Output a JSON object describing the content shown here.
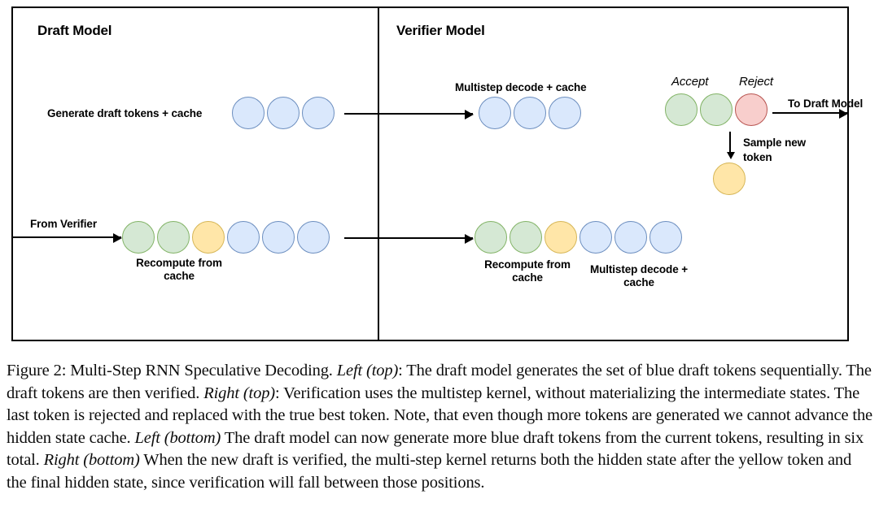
{
  "figure": {
    "panels": {
      "left": {
        "title": "Draft Model"
      },
      "right": {
        "title": "Verifier Model"
      }
    },
    "labels": {
      "generate_draft": "Generate draft tokens + cache",
      "multistep_top": "Multistep decode + cache",
      "accept": "Accept",
      "reject": "Reject",
      "to_draft_model": "To Draft Model",
      "sample_new_token_line1": "Sample new",
      "sample_new_token_line2": "token",
      "from_verifier": "From Verifier",
      "recompute_left_line1": "Recompute from",
      "recompute_left_line2": "cache",
      "recompute_right_line1": "Recompute from",
      "recompute_right_line2": "cache",
      "multistep_bottom_line1": "Multistep decode +",
      "multistep_bottom_line2": "cache"
    },
    "token_rows": {
      "draft_top": [
        "blue",
        "blue",
        "blue"
      ],
      "verifier_top": [
        "blue",
        "blue",
        "blue"
      ],
      "verdict": [
        "green",
        "green",
        "red"
      ],
      "sampled": [
        "yellow"
      ],
      "draft_bottom": [
        "green",
        "green",
        "yellow",
        "blue",
        "blue",
        "blue"
      ],
      "verifier_bottom": [
        "green",
        "green",
        "yellow",
        "blue",
        "blue",
        "blue"
      ]
    },
    "colors": {
      "blue_fill": "#dae8fc",
      "blue_stroke": "#6c8ebf",
      "green_fill": "#d5e8d4",
      "green_stroke": "#82b366",
      "yellow_fill": "#ffe6a8",
      "yellow_stroke": "#d6b656",
      "red_fill": "#f8cecc",
      "red_stroke": "#b85450",
      "frame": "#000000"
    }
  },
  "caption": {
    "label": "Figure 2:",
    "title": "Multi-Step RNN Speculative Decoding.",
    "seg_left_top": "Left (top)",
    "text_1": ": The draft model generates the set of blue draft tokens sequentially. The draft tokens are then verified. ",
    "seg_right_top": "Right (top)",
    "text_2": ": Verification uses the multistep kernel, without materializing the intermediate states. The last token is rejected and replaced with the true best token. Note, that even though more tokens are generated we cannot advance the hidden state cache. ",
    "seg_left_bottom": "Left (bottom)",
    "text_3": " The draft model can now generate more blue draft tokens from the current tokens, resulting in six total. ",
    "seg_right_bottom": "Right (bottom)",
    "text_4": " When the new draft is verified, the multi-step kernel returns both the hidden state after the yellow token and the final hidden state, since verification will fall between those positions."
  }
}
